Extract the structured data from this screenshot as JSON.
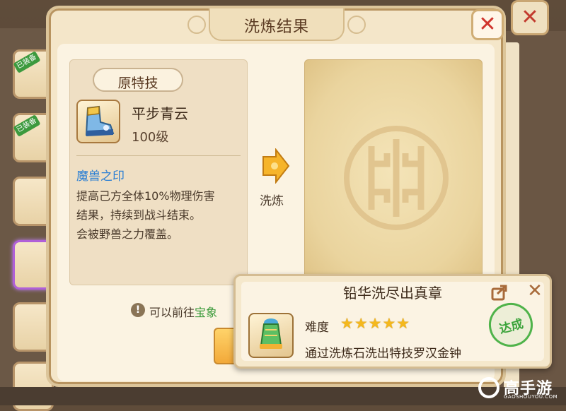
{
  "dialog": {
    "title": "洗炼结果",
    "close_icon": "close-icon"
  },
  "original_skill": {
    "tab_label": "原特技",
    "item_name": "平步青云",
    "item_level": "100级",
    "item_icon": "boots-icon",
    "skill_name": "魔兽之印",
    "skill_desc": [
      "提高己方全体10%物理伤害",
      "结果，持续到战斗结束。",
      "会被野兽之力覆盖。"
    ]
  },
  "refine_arrow": {
    "label": "洗炼",
    "icon": "arrow-right-icon"
  },
  "result_panel": {
    "emblem": "emblem-icon"
  },
  "hint": {
    "text": "可以前往",
    "link": "宝象",
    "icon": "info-icon"
  },
  "achievement": {
    "title": "铅华洗尽出真章",
    "difficulty_label": "难度",
    "stars": 5,
    "stars_text": "★★★★★",
    "description": "通过洗炼石洗出特技罗汉金钟",
    "stamp": "达成",
    "icon": "bell-item-icon",
    "share_icon": "share-icon",
    "close_icon": "close-icon"
  },
  "background": {
    "equipped_tag": "已装备"
  },
  "watermark": {
    "name": "高手游",
    "sub": "GAOSHOUYOU.COM"
  },
  "colors": {
    "accent_red": "#d0342c",
    "link_green": "#3a9a3a",
    "skill_blue": "#2b7fd4",
    "star_gold": "#f4b81e"
  }
}
